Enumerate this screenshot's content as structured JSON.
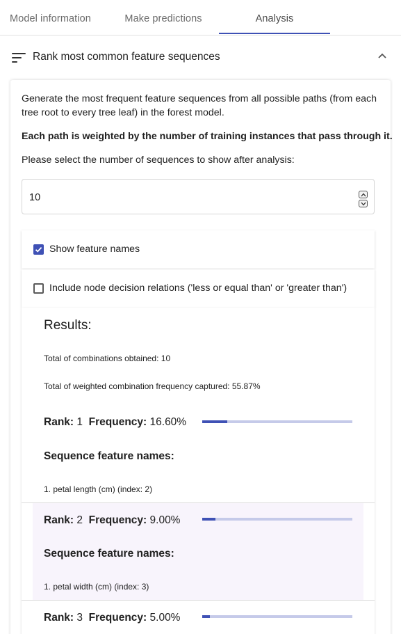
{
  "tabs": [
    {
      "label": "Model information"
    },
    {
      "label": "Make predictions"
    },
    {
      "label": "Analysis"
    }
  ],
  "panel": {
    "title": "Rank most common feature sequences",
    "description": "Generate the most frequent feature sequences from all possible paths (from each tree root to every tree leaf) in the forest model.",
    "description_line1": "Generate the most frequent feature sequences from all possible paths (from each",
    "description_line2": "tree root to every tree leaf) in the forest model.",
    "weight_note": "Each path is weighted by the number of training instances that pass through it.",
    "select_prompt": "Please select the number of sequences to show after analysis:",
    "num_sequences": "10",
    "show_feature_names": {
      "label": "Show feature names",
      "checked": true
    },
    "include_relations": {
      "label": "Include node decision relations ('less or equal than' or 'greater than')",
      "checked": false
    }
  },
  "results": {
    "title": "Results:",
    "total_combinations": "Total of combinations obtained: 10",
    "total_frequency": "Total of weighted combination frequency captured: 55.87%",
    "rank_label": "Rank:",
    "frequency_label": "Frequency:",
    "sequence_heading": "Sequence feature names:",
    "items": [
      {
        "rank": "1",
        "frequency": "16.60%",
        "fraction": 0.166,
        "features": [
          "1. petal length (cm) (index: 2)"
        ]
      },
      {
        "rank": "2",
        "frequency": "9.00%",
        "fraction": 0.09,
        "features": [
          "1. petal width (cm) (index: 3)"
        ]
      },
      {
        "rank": "3",
        "frequency": "5.00%",
        "fraction": 0.05,
        "features": []
      }
    ]
  },
  "colors": {
    "accent": "#3f51b5",
    "track": "#c5cae9",
    "highlight": "#f8f4fc"
  }
}
